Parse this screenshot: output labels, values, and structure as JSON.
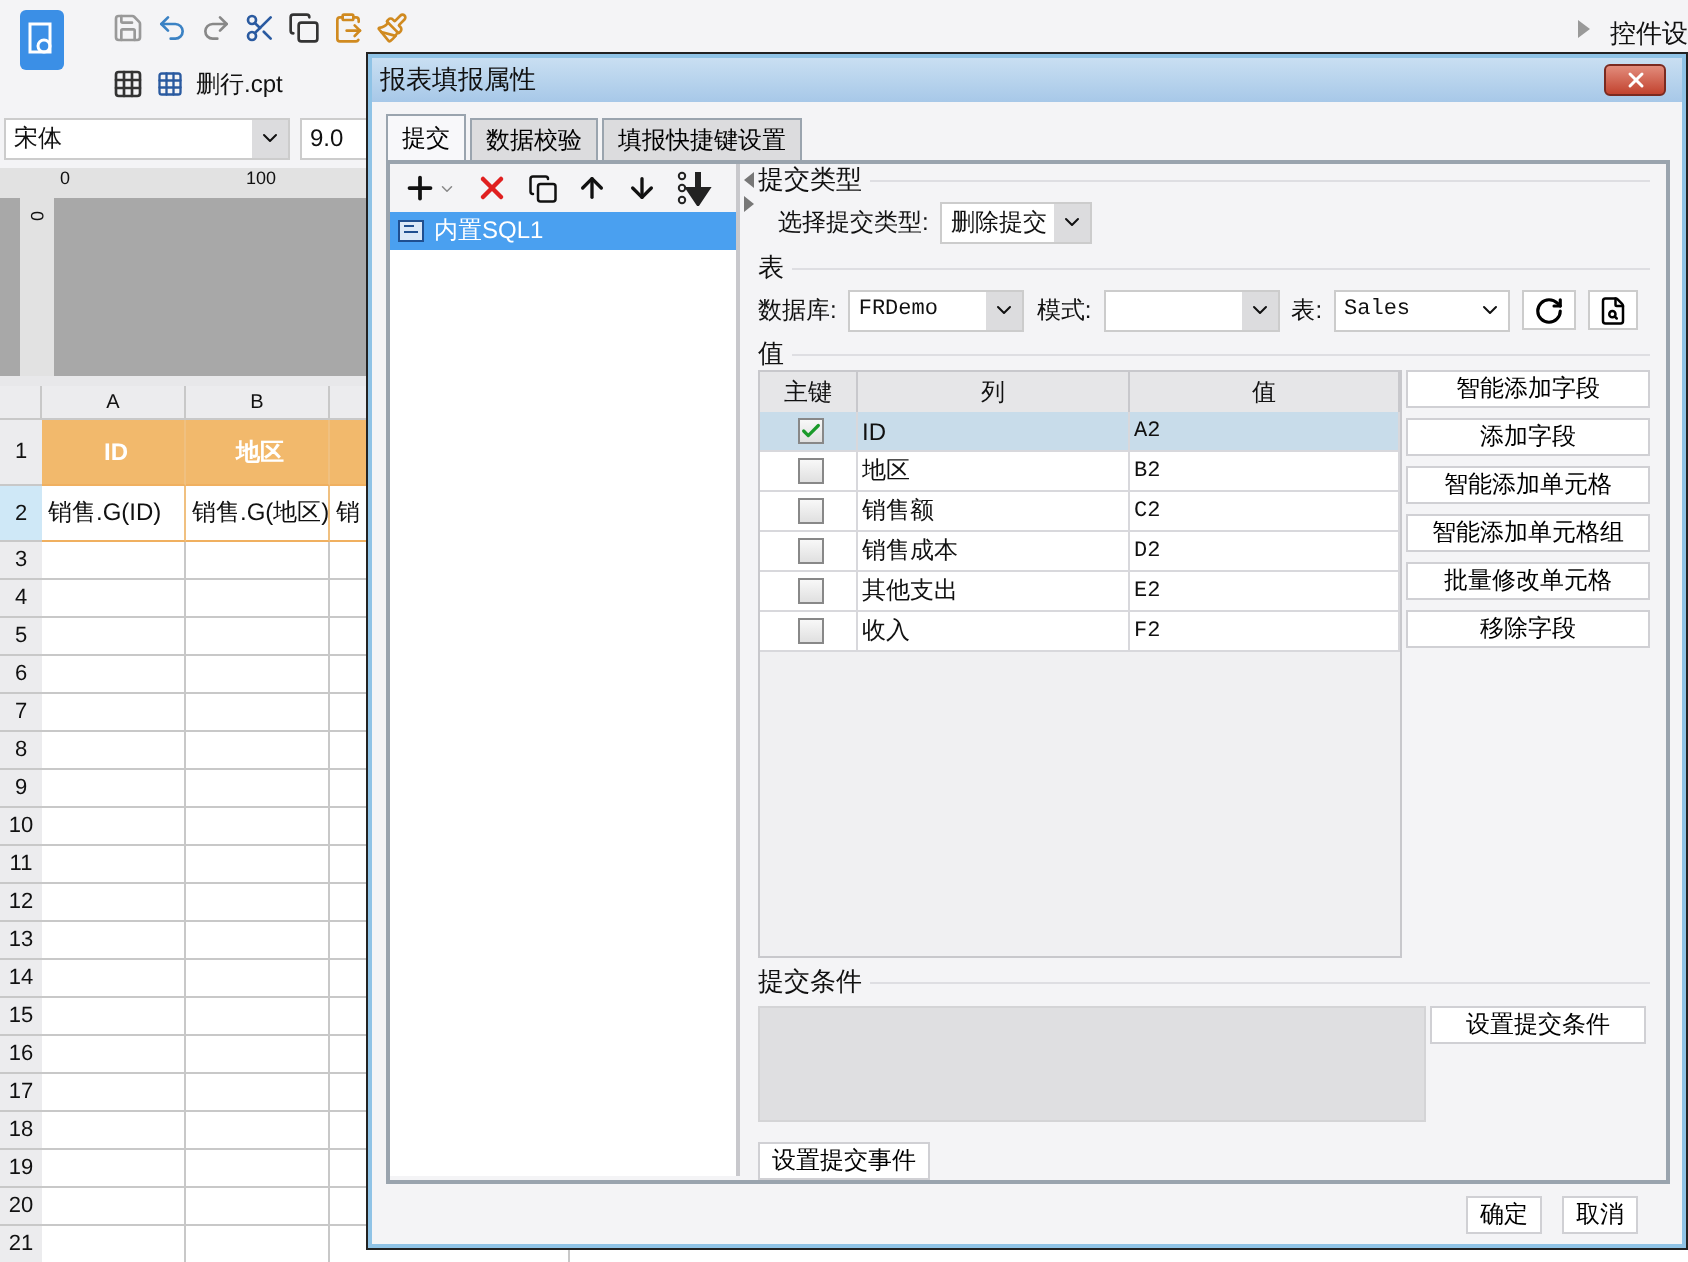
{
  "app": {
    "file_tab": "删行.cpt",
    "font": "宋体",
    "font_size": "9.0",
    "side_panel_title": "控件设",
    "ruler_labels": [
      "0",
      "100"
    ],
    "vertical_ruler_label": "0"
  },
  "sheet": {
    "columns": [
      "A",
      "B"
    ],
    "rows": [
      {
        "number": "1",
        "kind": "title",
        "selected": false,
        "cells": [
          "ID",
          "地区"
        ]
      },
      {
        "number": "2",
        "kind": "data",
        "selected": true,
        "cells": [
          "销售.G(ID)",
          "销售.G(地区)",
          "销"
        ]
      },
      {
        "number": "3",
        "kind": "blank",
        "selected": false
      },
      {
        "number": "4",
        "kind": "blank",
        "selected": false
      },
      {
        "number": "5",
        "kind": "blank",
        "selected": false
      },
      {
        "number": "6",
        "kind": "blank",
        "selected": false
      },
      {
        "number": "7",
        "kind": "blank",
        "selected": false
      },
      {
        "number": "8",
        "kind": "blank",
        "selected": false
      },
      {
        "number": "9",
        "kind": "blank",
        "selected": false
      },
      {
        "number": "10",
        "kind": "blank",
        "selected": false
      },
      {
        "number": "11",
        "kind": "blank",
        "selected": false
      },
      {
        "number": "12",
        "kind": "blank",
        "selected": false
      },
      {
        "number": "13",
        "kind": "blank",
        "selected": false
      },
      {
        "number": "14",
        "kind": "blank",
        "selected": false
      },
      {
        "number": "15",
        "kind": "blank",
        "selected": false
      },
      {
        "number": "16",
        "kind": "blank",
        "selected": false
      },
      {
        "number": "17",
        "kind": "blank",
        "selected": false
      },
      {
        "number": "18",
        "kind": "blank",
        "selected": false
      },
      {
        "number": "19",
        "kind": "blank",
        "selected": false
      },
      {
        "number": "20",
        "kind": "blank",
        "selected": false
      },
      {
        "number": "21",
        "kind": "blank",
        "selected": false
      }
    ]
  },
  "dialog": {
    "title": "报表填报属性",
    "tabs": [
      {
        "label": "提交",
        "selected": true
      },
      {
        "label": "数据校验",
        "selected": false
      },
      {
        "label": "填报快捷键设置",
        "selected": false
      }
    ],
    "submissions": [
      {
        "label": "内置SQL1",
        "selected": true
      }
    ],
    "submit_type": {
      "legend": "提交类型",
      "label": "选择提交类型:",
      "value": "删除提交"
    },
    "table_section": {
      "legend": "表",
      "database_label": "数据库:",
      "database": "FRDemo",
      "schema_label": "模式:",
      "table_label": "表:",
      "table": "Sales"
    },
    "values": {
      "legend": "值",
      "columns": [
        "主键",
        "列",
        "值"
      ],
      "rows": [
        {
          "checked": true,
          "selected": true,
          "column": "ID",
          "value": "A2"
        },
        {
          "checked": false,
          "selected": false,
          "column": "地区",
          "value": "B2"
        },
        {
          "checked": false,
          "selected": false,
          "column": "销售额",
          "value": "C2"
        },
        {
          "checked": false,
          "selected": false,
          "column": "销售成本",
          "value": "D2"
        },
        {
          "checked": false,
          "selected": false,
          "column": "其他支出",
          "value": "E2"
        },
        {
          "checked": false,
          "selected": false,
          "column": "收入",
          "value": "F2"
        }
      ],
      "buttons": [
        "智能添加字段",
        "添加字段",
        "智能添加单元格",
        "智能添加单元格组",
        "批量修改单元格",
        "移除字段"
      ]
    },
    "condition": {
      "legend": "提交条件",
      "button": "设置提交条件"
    },
    "event_button": "设置提交事件",
    "buttons": [
      "确定",
      "取消"
    ]
  }
}
